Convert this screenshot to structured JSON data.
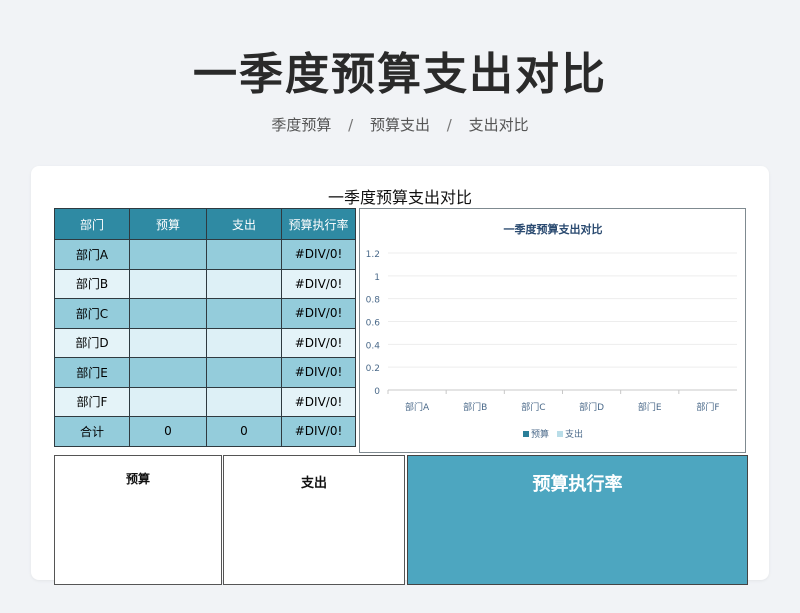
{
  "page": {
    "title": "一季度预算支出对比",
    "breadcrumb": [
      "季度预算",
      "预算支出",
      "支出对比"
    ],
    "breadcrumb_sep": "/"
  },
  "sheet": {
    "title": "一季度预算支出对比",
    "headers": [
      "部门",
      "预算",
      "支出",
      "预算执行率"
    ],
    "rows": [
      {
        "dept": "部门A",
        "budget": "",
        "expense": "",
        "rate": "#DIV/0!"
      },
      {
        "dept": "部门B",
        "budget": "",
        "expense": "",
        "rate": "#DIV/0!"
      },
      {
        "dept": "部门C",
        "budget": "",
        "expense": "",
        "rate": "#DIV/0!"
      },
      {
        "dept": "部门D",
        "budget": "",
        "expense": "",
        "rate": "#DIV/0!"
      },
      {
        "dept": "部门E",
        "budget": "",
        "expense": "",
        "rate": "#DIV/0!"
      },
      {
        "dept": "部门F",
        "budget": "",
        "expense": "",
        "rate": "#DIV/0!"
      }
    ],
    "total": {
      "label": "合计",
      "budget": "0",
      "expense": "0",
      "rate": "#DIV/0!"
    }
  },
  "panels": {
    "budget": "预算",
    "expense": "支出",
    "rate": "预算执行率"
  },
  "chart_data": {
    "type": "bar",
    "title": "一季度预算支出对比",
    "categories": [
      "部门A",
      "部门B",
      "部门C",
      "部门D",
      "部门E",
      "部门F"
    ],
    "series": [
      {
        "name": "预算",
        "values": [
          0,
          0,
          0,
          0,
          0,
          0
        ],
        "color": "#2b7f99"
      },
      {
        "name": "支出",
        "values": [
          0,
          0,
          0,
          0,
          0,
          0
        ],
        "color": "#b9dde8"
      }
    ],
    "yticks": [
      "0",
      "0.2",
      "0.4",
      "0.6",
      "0.8",
      "1",
      "1.2"
    ],
    "ylim": [
      0,
      1.2
    ],
    "legend": "bottom",
    "grid": true
  },
  "colors": {
    "header": "#2f8aa3",
    "row_dark": "#94ccdb",
    "row_light": "#ddf0f6",
    "rate_panel": "#4da6c0"
  }
}
